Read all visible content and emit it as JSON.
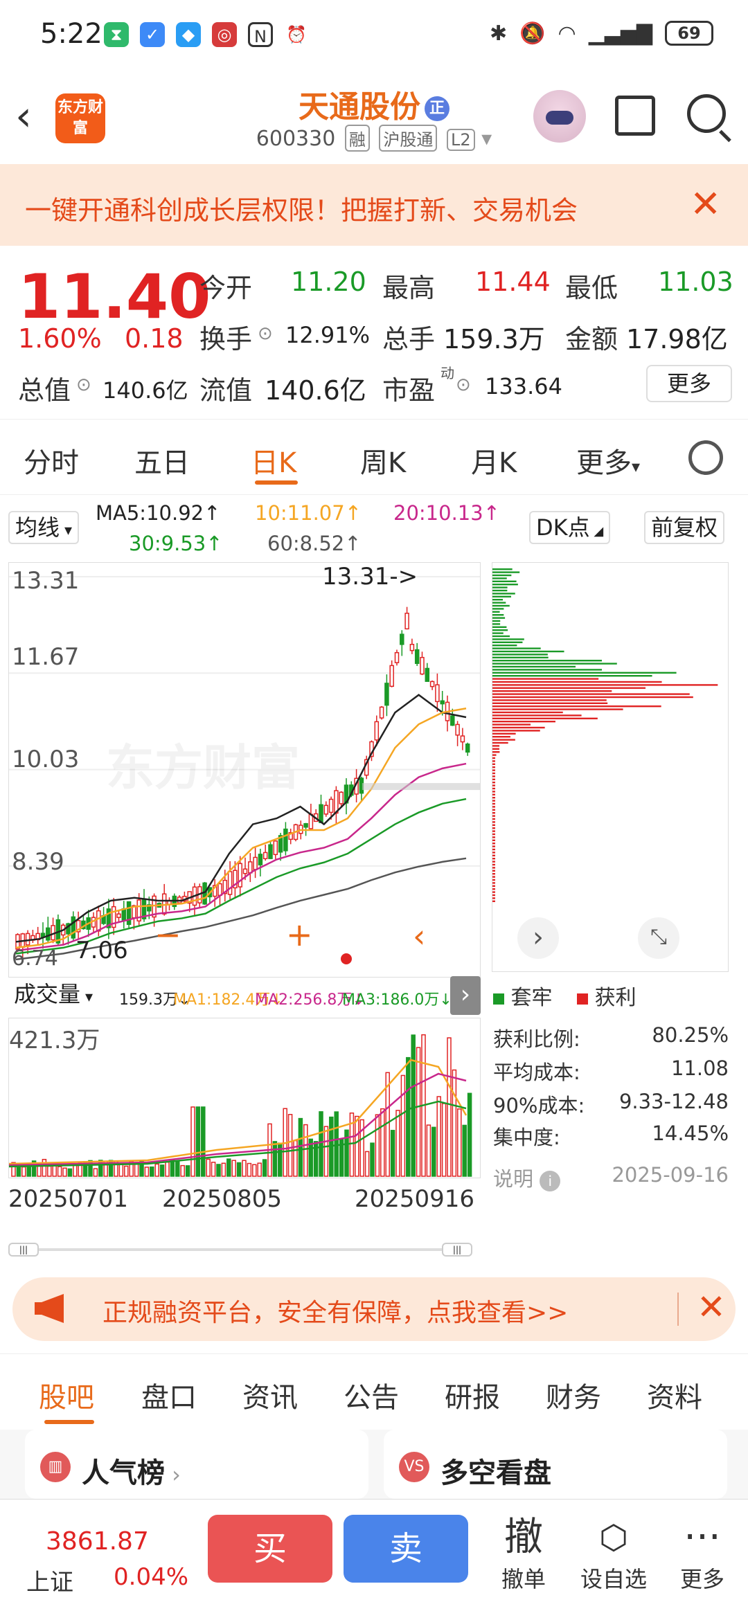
{
  "status": {
    "time": "5:22",
    "battery": "69",
    "icons": [
      "hourglass-icon",
      "shield-icon",
      "vpn-icon",
      "bank-icon",
      "nfc-icon",
      "alarm-icon",
      "bluetooth-icon",
      "mute-icon",
      "wifi-icon",
      "signal-icon"
    ]
  },
  "header": {
    "logo": "东方财富",
    "title": "天通股份",
    "badge": "正",
    "code": "600330",
    "tags": [
      "融",
      "沪股通",
      "L2"
    ]
  },
  "banner": {
    "text": "一键开通科创成长层权限！把握打新、交易机会"
  },
  "quote": {
    "price": "11.40",
    "change_pct": "1.60%",
    "change_amt": "0.18",
    "open_label": "今开",
    "open": "11.20",
    "high_label": "最高",
    "high": "11.44",
    "low_label": "最低",
    "low": "11.03",
    "turnover_label": "换手",
    "turnover": "12.91%",
    "volume_label": "总手",
    "volume": "159.3万",
    "amount_label": "金额",
    "amount": "17.98亿",
    "mktcap_label": "总值",
    "mktcap": "140.6亿",
    "float_label": "流值",
    "float": "140.6亿",
    "pe_label": "市盈",
    "pe_sup": "动",
    "pe": "133.64",
    "more": "更多"
  },
  "tabs": [
    "分时",
    "五日",
    "日K",
    "周K",
    "月K",
    "更多"
  ],
  "active_tab": "日K",
  "ma": {
    "selector": "均线",
    "ma5": "MA5:10.92↑",
    "ma10": "10:11.07↑",
    "ma20": "20:10.13↑",
    "ma30": "30:9.53↑",
    "ma60": "60:8.52↑",
    "dk": "DK点",
    "adjust": "前复权",
    "color_ma5": "#222222",
    "color_ma10": "#f5a623",
    "color_ma20": "#c8278b",
    "color_ma30": "#1a9a27",
    "color_ma60": "#555555"
  },
  "kchart": {
    "y_labels": [
      "13.31",
      "11.67",
      "10.03",
      "8.39",
      "6.74"
    ],
    "max_note": "13.31->",
    "min_note": "7.06",
    "watermark": "东方财富"
  },
  "volume": {
    "selector": "成交量",
    "vol": "159.3万↓",
    "ma1": "MA1:182.4万↓",
    "ma2": "MA2:256.8万↓",
    "ma3": "MA3:186.0万↓",
    "max_label": "421.3万",
    "dates": [
      "20250701",
      "20250805",
      "20250916"
    ]
  },
  "chip": {
    "legend_hold": "套牢",
    "legend_profit": "获利",
    "profit_ratio_label": "获利比例:",
    "profit_ratio": "80.25%",
    "avg_cost_label": "平均成本:",
    "avg_cost": "11.08",
    "cost90_label": "90%成本:",
    "cost90": "9.33-12.48",
    "concentration_label": "集中度:",
    "concentration": "14.45%",
    "note_label": "说明",
    "date": "2025-09-16"
  },
  "ad": {
    "text": "正规融资平台，安全有保障，点我查看>>"
  },
  "bottom_tabs": [
    "股吧",
    "盘口",
    "资讯",
    "公告",
    "研报",
    "财务",
    "资料"
  ],
  "cards": [
    {
      "title": "人气榜",
      "icon": "bar-chart-icon"
    },
    {
      "title": "多空看盘",
      "icon": "vs-icon"
    }
  ],
  "index": {
    "value": "3861.87",
    "name": "上证",
    "pct": "0.04%"
  },
  "actions": {
    "buy": "买",
    "sell": "卖",
    "cancel_big": "撤",
    "cancel": "撤单",
    "watch": "设自选",
    "more": "更多"
  },
  "chart_data": {
    "type": "candlestick",
    "title": "",
    "ylim": [
      6.74,
      13.31
    ],
    "x_ticks": [
      "20250701",
      "20250805",
      "20250916"
    ],
    "series": [
      {
        "name": "MA5",
        "values": [
          7.1,
          7.15,
          7.3,
          7.6,
          7.8,
          7.85,
          7.8,
          7.8,
          7.95,
          8.6,
          9.1,
          9.2,
          9.4,
          9.1,
          9.5,
          10.3,
          11.0,
          11.3,
          11.0,
          10.92
        ]
      },
      {
        "name": "MA10",
        "values": [
          7.0,
          7.05,
          7.15,
          7.4,
          7.6,
          7.7,
          7.72,
          7.75,
          7.85,
          8.3,
          8.7,
          8.85,
          9.0,
          9.0,
          9.2,
          9.7,
          10.4,
          10.8,
          11.0,
          11.07
        ]
      },
      {
        "name": "MA20",
        "values": [
          6.95,
          7.0,
          7.05,
          7.2,
          7.4,
          7.5,
          7.58,
          7.62,
          7.7,
          8.0,
          8.3,
          8.5,
          8.62,
          8.7,
          8.85,
          9.2,
          9.6,
          9.9,
          10.05,
          10.13
        ]
      },
      {
        "name": "MA30",
        "values": [
          6.9,
          6.95,
          7.0,
          7.1,
          7.25,
          7.35,
          7.45,
          7.5,
          7.58,
          7.8,
          8.0,
          8.2,
          8.35,
          8.45,
          8.6,
          8.85,
          9.1,
          9.3,
          9.45,
          9.53
        ]
      },
      {
        "name": "MA60",
        "values": [
          6.8,
          6.85,
          6.9,
          6.98,
          7.05,
          7.12,
          7.2,
          7.28,
          7.35,
          7.45,
          7.55,
          7.68,
          7.8,
          7.9,
          8.0,
          8.15,
          8.28,
          8.38,
          8.46,
          8.52
        ]
      }
    ],
    "volume_max": "421.3万"
  }
}
